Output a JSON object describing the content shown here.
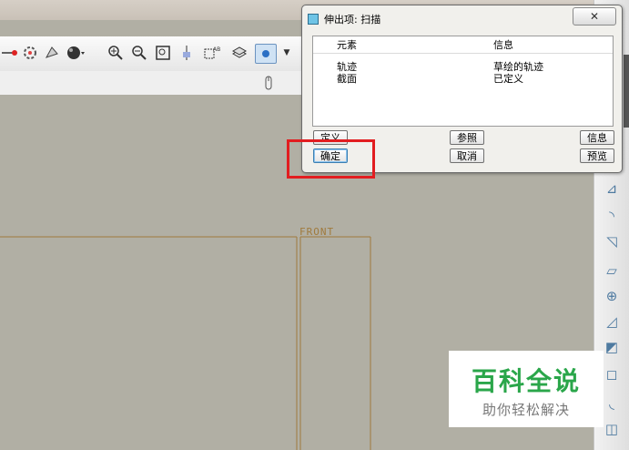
{
  "dialog": {
    "title": "伸出项: 扫描",
    "close_label": "✕",
    "columns": [
      "元素",
      "信息"
    ],
    "rows": [
      {
        "element": "轨迹",
        "info": "草绘的轨迹"
      },
      {
        "element": "截面",
        "info": "已定义"
      }
    ],
    "buttons": {
      "define": "定义",
      "refs": "参照",
      "info": "信息",
      "ok": "确定",
      "cancel": "取消",
      "preview": "预览"
    }
  },
  "viewport": {
    "datum_label": "FRONT"
  },
  "toolbar": {
    "icons": [
      "sketch-icon",
      "settings-icon",
      "orient-icon",
      "shade-icon",
      "zoom-in-icon",
      "zoom-out-icon",
      "refit-icon",
      "plane-icon",
      "axis-icon",
      "layer-icon",
      "point-icon"
    ]
  },
  "watermark": {
    "title": "百科全说",
    "subtitle": "助你轻松解决"
  },
  "colors": {
    "highlight": "#e21d20",
    "datum": "#a07a3c",
    "logo": "#2aa64a"
  }
}
